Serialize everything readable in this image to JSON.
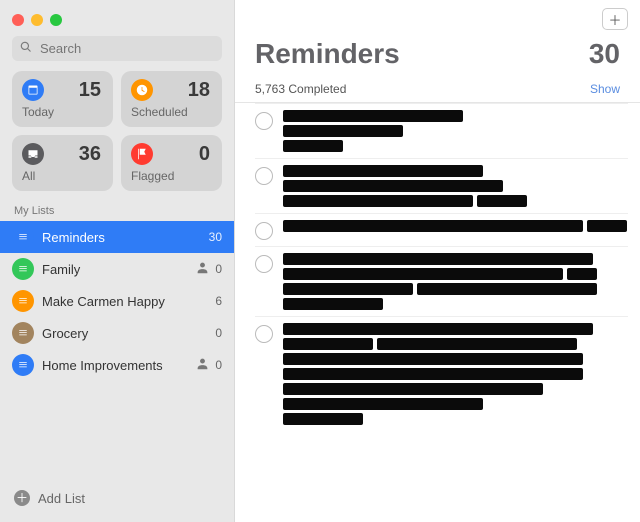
{
  "window": {
    "title": "Reminders"
  },
  "search": {
    "placeholder": "Search"
  },
  "smart": [
    {
      "id": "today",
      "label": "Today",
      "count": 15,
      "icon": "calendar",
      "colorClass": "ic-blue"
    },
    {
      "id": "scheduled",
      "label": "Scheduled",
      "count": 18,
      "icon": "clock",
      "colorClass": "ic-orange"
    },
    {
      "id": "all",
      "label": "All",
      "count": 36,
      "icon": "tray",
      "colorClass": "ic-grey"
    },
    {
      "id": "flagged",
      "label": "Flagged",
      "count": 0,
      "icon": "flag",
      "colorClass": "ic-red"
    }
  ],
  "sidebar": {
    "sectionTitle": "My Lists",
    "addList": "Add List"
  },
  "lists": [
    {
      "name": "Reminders",
      "count": 30,
      "colorClass": "lc-blue",
      "shared": false,
      "selected": true
    },
    {
      "name": "Family",
      "count": 0,
      "colorClass": "lc-green",
      "shared": true,
      "selected": false
    },
    {
      "name": "Make Carmen Happy",
      "count": 6,
      "colorClass": "lc-orange",
      "shared": false,
      "selected": false
    },
    {
      "name": "Grocery",
      "count": 0,
      "colorClass": "lc-brown",
      "shared": false,
      "selected": false
    },
    {
      "name": "Home Improvements",
      "count": 0,
      "colorClass": "lc-blue",
      "shared": true,
      "selected": false
    }
  ],
  "main": {
    "title": "Reminders",
    "count": 30,
    "completedText": "5,763 Completed",
    "showLabel": "Show"
  },
  "redactedItems": [
    {
      "lines": [
        [
          180
        ],
        [
          120
        ],
        [
          60
        ]
      ]
    },
    {
      "lines": [
        [
          200
        ],
        [
          220
        ],
        [
          190,
          50
        ]
      ]
    },
    {
      "lines": [
        [
          300,
          40
        ]
      ]
    },
    {
      "lines": [
        [
          310
        ],
        [
          280,
          30
        ],
        [
          130,
          180
        ],
        [
          100
        ]
      ]
    },
    {
      "lines": [
        [
          310
        ],
        [
          90,
          200
        ],
        [
          300
        ],
        [
          300
        ],
        [
          260
        ],
        [
          200
        ],
        [
          80
        ]
      ]
    }
  ]
}
